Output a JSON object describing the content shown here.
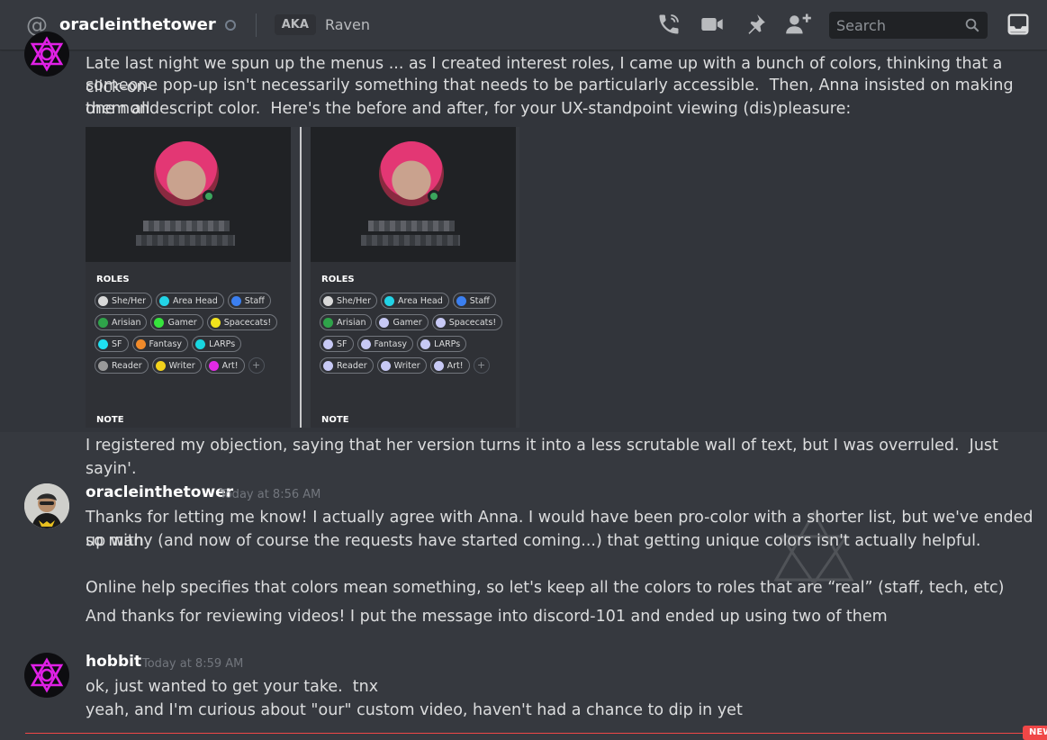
{
  "header": {
    "channel_name": "oracleinthetower",
    "aka_label": "AKA",
    "aka_name": "Raven",
    "search_placeholder": "Search"
  },
  "messages": [
    {
      "author": "",
      "time": "",
      "lines": [
        "Late last night we spun up the menus ... as I created interest roles, I came up with a bunch of colors, thinking that a click-on-",
        "someone pop-up isn't necessarily something that needs to be particularly accessible.  Then, Anna insisted on making them all",
        "one nondescript color.  Here's the before and after, for your UX-standpoint viewing (dis)pleasure:"
      ],
      "after_image": "I registered my objection, saying that her version turns it into a less scrutable wall of text, but I was overruled.  Just sayin'."
    },
    {
      "author": "oracleinthetower",
      "time": "Today at 8:56 AM",
      "lines": [
        "Thanks for letting me know! I actually agree with Anna. I would have been pro-color with a shorter list, but we've ended up with",
        "so many (and now of course the requests have started coming...) that getting unique colors isn't actually helpful.",
        "Online help specifies that colors mean something, so let's keep all the colors to roles that are “real” (staff, tech, etc)",
        "And thanks for reviewing videos! I put the message into discord-101 and ended up using two of them"
      ]
    },
    {
      "author": "hobbit",
      "time": "Today at 8:59 AM",
      "lines": [
        "ok, just wanted to get your take.  tnx",
        "yeah, and I'm curious about \"our\" custom video, haven't had a chance to dip in yet"
      ]
    }
  ],
  "embed": {
    "roles_heading": "ROLES",
    "note_heading": "NOTE",
    "before_roles": [
      {
        "label": "She/Her",
        "color": "#d9d9d9"
      },
      {
        "label": "Area Head",
        "color": "#22d3e6"
      },
      {
        "label": "Staff",
        "color": "#3b7ff0"
      },
      {
        "label": "Arisian",
        "color": "#2fa34a"
      },
      {
        "label": "Gamer",
        "color": "#37e43d"
      },
      {
        "label": "Spacecats!",
        "color": "#f2e31c"
      },
      {
        "label": "SF",
        "color": "#1fe0f0"
      },
      {
        "label": "Fantasy",
        "color": "#f08a2a"
      },
      {
        "label": "LARPs",
        "color": "#18d6e0"
      },
      {
        "label": "Reader",
        "color": "#9a9a9a"
      },
      {
        "label": "Writer",
        "color": "#f2d21c"
      },
      {
        "label": "Art!",
        "color": "#e22ae6"
      }
    ],
    "after_roles": [
      {
        "label": "She/Her",
        "color": "#d9d9d9"
      },
      {
        "label": "Area Head",
        "color": "#22d3e6"
      },
      {
        "label": "Staff",
        "color": "#3b7ff0"
      },
      {
        "label": "Arisian",
        "color": "#2fa34a"
      },
      {
        "label": "Gamer",
        "color": "#c7c9f5"
      },
      {
        "label": "Spacecats!",
        "color": "#c7c9f5"
      },
      {
        "label": "SF",
        "color": "#c7c9f5"
      },
      {
        "label": "Fantasy",
        "color": "#c7c9f5"
      },
      {
        "label": "LARPs",
        "color": "#c7c9f5"
      },
      {
        "label": "Reader",
        "color": "#c7c9f5"
      },
      {
        "label": "Writer",
        "color": "#c7c9f5"
      },
      {
        "label": "Art!",
        "color": "#c7c9f5"
      }
    ],
    "plus": "+"
  },
  "new_marker": "NEW",
  "icons": [
    "at-icon",
    "phone-call-icon",
    "video-call-icon",
    "pin-icon",
    "add-member-icon",
    "search-icon",
    "inbox-icon"
  ],
  "colors": {
    "background": "#36393f",
    "accent_red": "#f04747",
    "hobbit_avatar": "#e020e6"
  }
}
